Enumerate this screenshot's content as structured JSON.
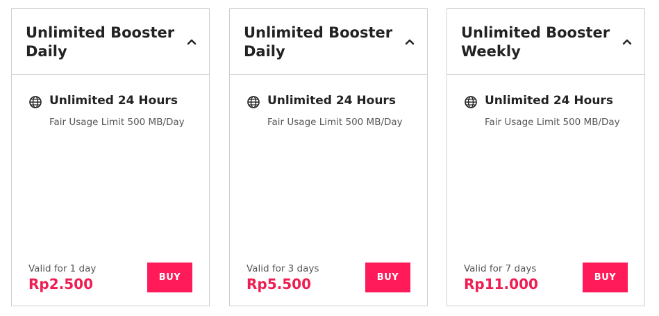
{
  "accent_color": "#ff1a5a",
  "cards": [
    {
      "title": "Unlimited Booster Daily",
      "feature_title": "Unlimited 24 Hours",
      "feature_desc": "Fair Usage Limit 500 MB/Day",
      "validity": "Valid for 1 day",
      "price": "Rp2.500",
      "buy_label": "BUY",
      "icons": [
        "chevron-up-icon",
        "globe-icon"
      ]
    },
    {
      "title": "Unlimited Booster Daily",
      "feature_title": "Unlimited 24 Hours",
      "feature_desc": "Fair Usage Limit 500 MB/Day",
      "validity": "Valid for 3 days",
      "price": "Rp5.500",
      "buy_label": "BUY",
      "icons": [
        "chevron-up-icon",
        "globe-icon"
      ]
    },
    {
      "title": "Unlimited Booster Weekly",
      "feature_title": "Unlimited 24 Hours",
      "feature_desc": "Fair Usage Limit 500 MB/Day",
      "validity": "Valid for 7 days",
      "price": "Rp11.000",
      "buy_label": "BUY",
      "icons": [
        "chevron-up-icon",
        "globe-icon"
      ]
    }
  ]
}
